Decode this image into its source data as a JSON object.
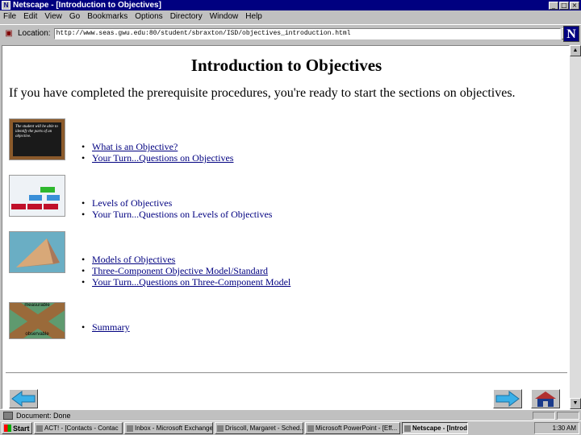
{
  "window": {
    "title": "Netscape - [Introduction to Objectives]",
    "minimize": "_",
    "maximize": "□",
    "close": "×"
  },
  "menu": [
    "File",
    "Edit",
    "View",
    "Go",
    "Bookmarks",
    "Options",
    "Directory",
    "Window",
    "Help"
  ],
  "location": {
    "label": "Location:",
    "url": "http://www.seas.gwu.edu:80/student/sbraxton/ISD/objectives_introduction.html",
    "dropdown": "▼",
    "logo": "N"
  },
  "page": {
    "title": "Introduction to Objectives",
    "intro": "If you have completed the prerequisite procedures, you're ready to start the sections on objectives.",
    "sections": [
      {
        "thumb_text": "The student will be able to identify the parts of an objective.",
        "links": [
          "What is an Objective?",
          "Your Turn...Questions on Objectives"
        ]
      },
      {
        "links": [
          "Levels of Objectives",
          "Your Turn...Questions on Levels of Objectives"
        ]
      },
      {
        "links": [
          "Models of Objectives",
          "Three-Component Objective Model/Standard",
          "Your Turn...Questions on Three-Component Model"
        ]
      },
      {
        "thumb_top": "measurable",
        "thumb_bottom": "observable",
        "links": [
          "Summary"
        ]
      }
    ]
  },
  "status": {
    "text": "Document: Done"
  },
  "taskbar": {
    "start": "Start",
    "tasks": [
      "ACT! - [Contacts - Contac",
      "Inbox - Microsoft Exchange",
      "Driscoll, Margaret - Sched...",
      "Microsoft PowerPoint - [Eff...",
      "Netscape - [Introduct..."
    ],
    "clock": "1:30 AM"
  },
  "colors": {
    "titlebar": "#000080",
    "link": "#000080",
    "chrome": "#c0c0c0"
  }
}
